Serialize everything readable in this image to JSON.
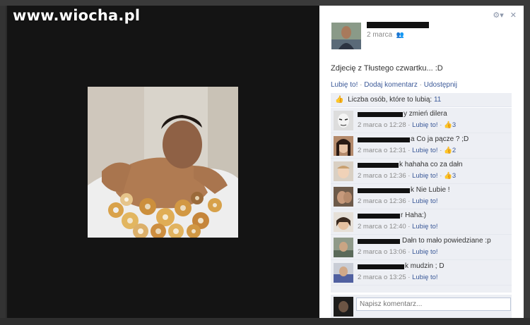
{
  "watermark": "www.wiocha.pl",
  "lightbox": {
    "photo_icon": "photo-donuts-bathtub",
    "owner": {
      "date": "2 marca"
    },
    "caption": "Zdjecię z Tłustego czwartku... :D",
    "actions": {
      "like": "Lubię to!",
      "comment": "Dodaj komentarz",
      "share": "Udostępnij",
      "sep": " · "
    },
    "likes": {
      "label": "Liczba osób, które to lubią:",
      "count": "11"
    },
    "comments": [
      {
        "text": "y zmień dilera",
        "time": "2 marca o 12:28",
        "like": "Lubię to!",
        "likes": "3"
      },
      {
        "text": "a Co ja pącze ? ;D",
        "time": "2 marca o 12:31",
        "like": "Lubię to!",
        "likes": "2"
      },
      {
        "text": "k hahaha co za dałn",
        "time": "2 marca o 12:36",
        "like": "Lubię to!",
        "likes": "3"
      },
      {
        "text": "k Nie Lubie !",
        "time": "2 marca o 12:36",
        "like": "Lubię to!",
        "likes": ""
      },
      {
        "text": "r Haha:)",
        "time": "2 marca o 12:40",
        "like": "Lubię to!",
        "likes": ""
      },
      {
        "text": "Dałn to mało powiedziane :p",
        "time": "2 marca o 13:06",
        "like": "Lubię to!",
        "likes": ""
      },
      {
        "text": "k mudzin ; D",
        "time": "2 marca o 13:25",
        "like": "Lubię to!",
        "likes": ""
      }
    ],
    "write_placeholder": "Napisz komentarz...",
    "icons": {
      "settings": "gear-icon",
      "close": "close-icon",
      "thumb": "thumbs-up-icon"
    }
  }
}
